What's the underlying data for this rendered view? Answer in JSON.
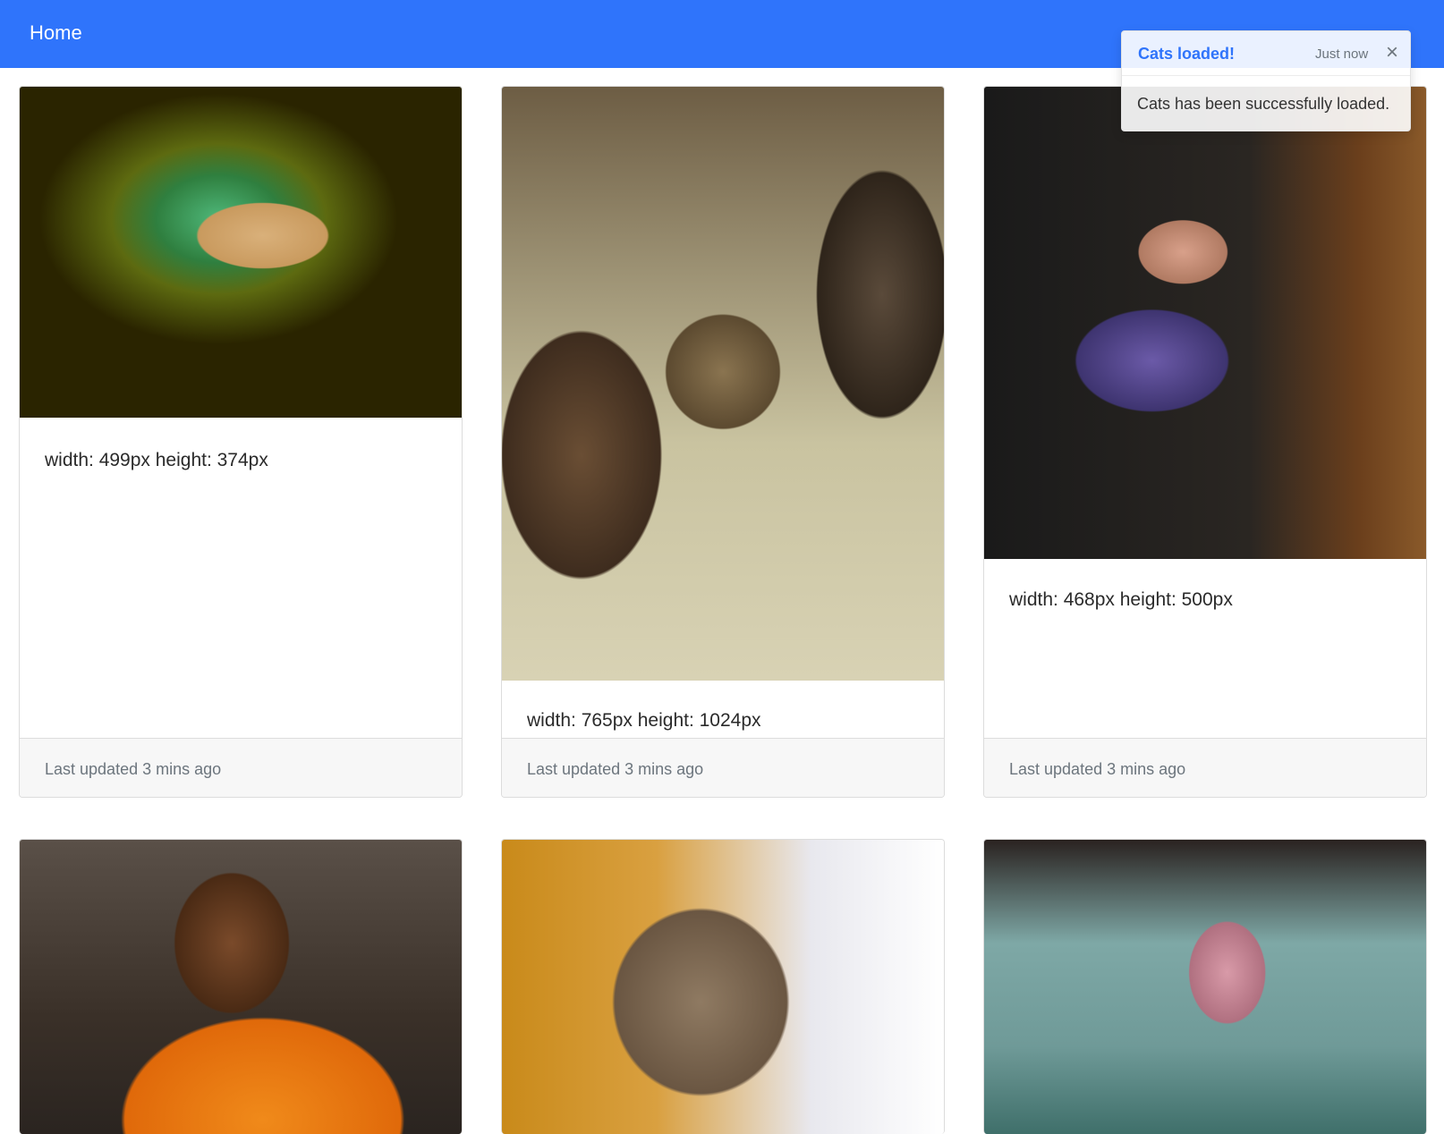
{
  "navbar": {
    "home_label": "Home"
  },
  "toast": {
    "title": "Cats loaded!",
    "time": "Just now",
    "close_icon": "×",
    "message": "Cats has been successfully loaded."
  },
  "cards": [
    {
      "image": "cat-in-space-image",
      "caption": "width: 499px height: 374px",
      "footer": "Last updated 3 mins ago"
    },
    {
      "image": "cat-on-pillows-image",
      "caption": "width: 765px height: 1024px",
      "footer": "Last updated 3 mins ago"
    },
    {
      "image": "cat-in-basket-image",
      "caption": "width: 468px height: 500px",
      "footer": "Last updated 3 mins ago"
    },
    {
      "image": "monk-image"
    },
    {
      "image": "kitten-image"
    },
    {
      "image": "cat-on-bed-image"
    }
  ],
  "colors": {
    "navbar": "#2f74fb",
    "toast_title": "#2f74fb",
    "footer_bg": "#f7f7f7"
  }
}
